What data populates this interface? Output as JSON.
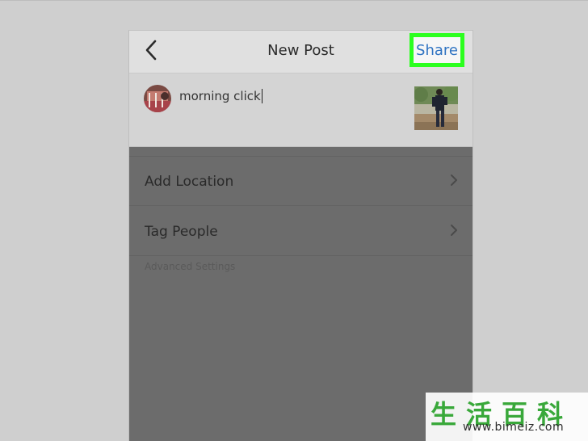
{
  "header": {
    "title": "New Post",
    "share_label": "Share"
  },
  "compose": {
    "caption": "morning click"
  },
  "options": [
    {
      "label": "Add Location"
    },
    {
      "label": "Tag People"
    }
  ],
  "advanced_settings_label": "Advanced Settings",
  "watermark": {
    "chars": "生活百科",
    "url": "www.bimeiz.com"
  },
  "colors": {
    "share_text": "#2f73c2",
    "share_highlight": "#2bff1e",
    "watermark_green": "#39a83a"
  },
  "icons": [
    "back-chevron-icon",
    "chevron-right-icon"
  ]
}
